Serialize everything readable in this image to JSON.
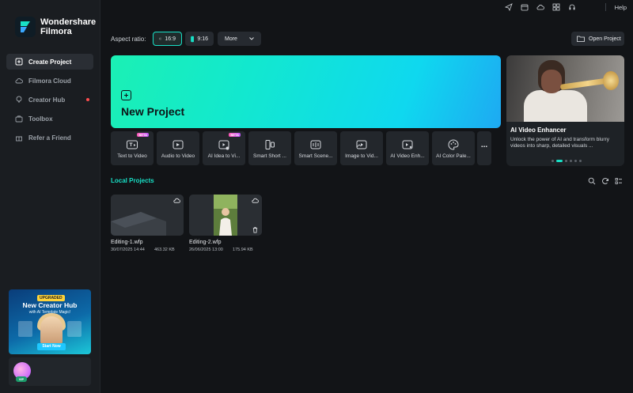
{
  "app": {
    "name_line1": "Wondershare",
    "name_line2": "Filmora"
  },
  "header": {
    "help": "Help",
    "icons": [
      "send-icon",
      "calendar-icon",
      "cloud-icon",
      "grid-icon",
      "headset-icon"
    ]
  },
  "sidebar": {
    "items": [
      {
        "label": "Create Project",
        "icon": "plus-square-icon",
        "active": true
      },
      {
        "label": "Filmora Cloud",
        "icon": "cloud-icon"
      },
      {
        "label": "Creator Hub",
        "icon": "bulb-icon",
        "dot": true
      },
      {
        "label": "Toolbox",
        "icon": "toolbox-icon"
      },
      {
        "label": "Refer a Friend",
        "icon": "gift-icon"
      }
    ],
    "promo": {
      "badge": "UPGRADED",
      "title": "New Creator Hub",
      "subtitle": "with AI Template Magic!",
      "button": "Start Now"
    },
    "user": {
      "badge": "VIP"
    }
  },
  "aspect": {
    "label": "Aspect ratio:",
    "r169": "16:9",
    "r916": "9:16",
    "more": "More"
  },
  "open_project": "Open Project",
  "new_project": {
    "title": "New Project"
  },
  "showcase": {
    "title": "AI Video Enhancer",
    "desc": "Unlock the power of AI and transform blurry videos into sharp, detailed visuals ...",
    "dots": 6,
    "active_dot": 1
  },
  "tools": [
    {
      "label": "Text to Video",
      "icon": "text-to-video-icon",
      "beta": "BETA"
    },
    {
      "label": "Audio to Video",
      "icon": "audio-to-video-icon"
    },
    {
      "label": "AI Idea to Vi...",
      "icon": "idea-to-video-icon",
      "beta": "BETA"
    },
    {
      "label": "Smart Short ...",
      "icon": "smart-short-icon"
    },
    {
      "label": "Smart Scene...",
      "icon": "smart-scene-icon"
    },
    {
      "label": "Image to Vid...",
      "icon": "image-to-video-icon"
    },
    {
      "label": "AI Video Enh...",
      "icon": "video-enhance-icon"
    },
    {
      "label": "AI Color Pale...",
      "icon": "color-palette-icon"
    }
  ],
  "tools_more": "...",
  "local_projects": {
    "title": "Local Projects",
    "items": [
      {
        "name": "Editing-1.wfp",
        "date": "30/07/2025 14:44",
        "size": "463.32 KB"
      },
      {
        "name": "Editing-2.wfp",
        "date": "26/06/2025 13:00",
        "size": "175.94 KB"
      }
    ]
  }
}
